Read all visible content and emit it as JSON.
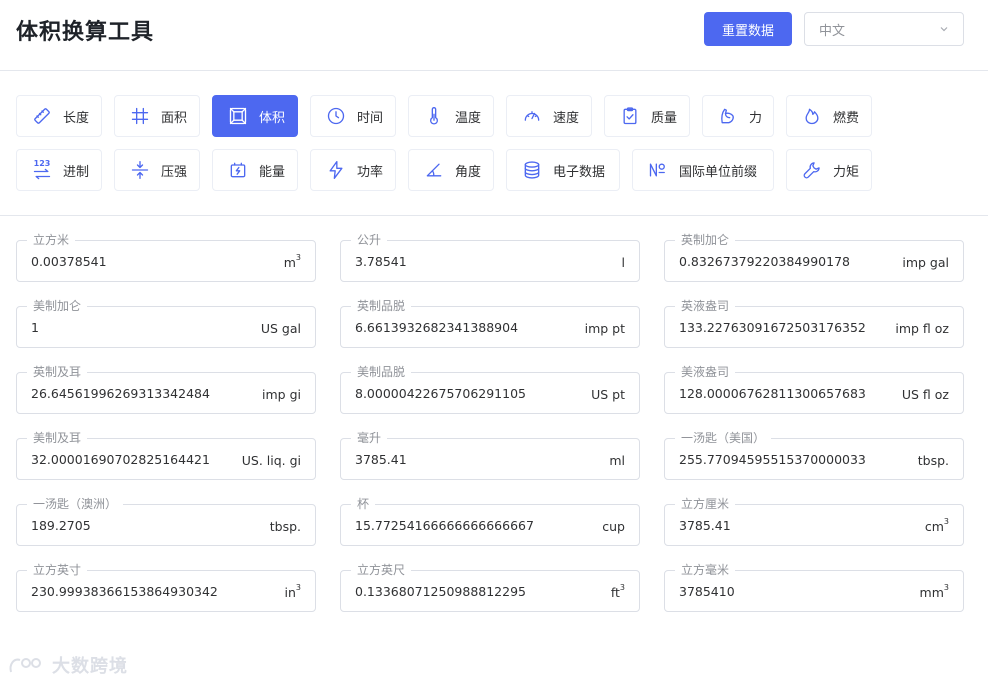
{
  "header": {
    "title": "体积换算工具",
    "reset_label": "重置数据",
    "language": "中文"
  },
  "categories": [
    {
      "label": "长度",
      "icon": "ruler-icon"
    },
    {
      "label": "面积",
      "icon": "grid-icon"
    },
    {
      "label": "体积",
      "icon": "cube-icon",
      "active": true
    },
    {
      "label": "时间",
      "icon": "clock-icon"
    },
    {
      "label": "温度",
      "icon": "thermometer-icon"
    },
    {
      "label": "速度",
      "icon": "speedometer-icon"
    },
    {
      "label": "质量",
      "icon": "clipboard-check-icon"
    },
    {
      "label": "力",
      "icon": "arm-icon"
    },
    {
      "label": "燃费",
      "icon": "flame-icon"
    },
    {
      "label": "进制",
      "icon": "base-123-icon"
    },
    {
      "label": "压强",
      "icon": "compress-icon"
    },
    {
      "label": "能量",
      "icon": "battery-icon"
    },
    {
      "label": "功率",
      "icon": "lightning-icon"
    },
    {
      "label": "角度",
      "icon": "angle-icon"
    },
    {
      "label": "电子数据",
      "icon": "database-icon"
    },
    {
      "label": "国际单位前缀",
      "icon": "numero-icon"
    },
    {
      "label": "力矩",
      "icon": "wrench-icon"
    }
  ],
  "icon_glyph": {
    "base": "123"
  },
  "fields": [
    {
      "label": "立方米",
      "value": "0.00378541",
      "unit": "m",
      "sup": "3"
    },
    {
      "label": "公升",
      "value": "3.78541",
      "unit": "l",
      "sup": ""
    },
    {
      "label": "英制加仑",
      "value": "0.83267379220384990178",
      "unit": "imp gal",
      "sup": ""
    },
    {
      "label": "美制加仑",
      "value": "1",
      "unit": "US gal",
      "sup": ""
    },
    {
      "label": "英制品脱",
      "value": "6.6613932682341388904",
      "unit": "imp pt",
      "sup": ""
    },
    {
      "label": "英液盎司",
      "value": "133.22763091672503176352",
      "unit": "imp fl oz",
      "sup": ""
    },
    {
      "label": "英制及耳",
      "value": "26.64561996269313342484",
      "unit": "imp gi",
      "sup": ""
    },
    {
      "label": "美制品脱",
      "value": "8.00000422675706291105",
      "unit": "US pt",
      "sup": ""
    },
    {
      "label": "美液盎司",
      "value": "128.00006762811300657683",
      "unit": "US fl oz",
      "sup": ""
    },
    {
      "label": "美制及耳",
      "value": "32.00001690702825164421",
      "unit": "US. liq. gi",
      "sup": ""
    },
    {
      "label": "毫升",
      "value": "3785.41",
      "unit": "ml",
      "sup": ""
    },
    {
      "label": "一汤匙（美国）",
      "value": "255.77094595515370000033",
      "unit": "tbsp.",
      "sup": ""
    },
    {
      "label": "一汤匙（澳洲）",
      "value": "189.2705",
      "unit": "tbsp.",
      "sup": ""
    },
    {
      "label": "杯",
      "value": "15.77254166666666666667",
      "unit": "cup",
      "sup": ""
    },
    {
      "label": "立方厘米",
      "value": "3785.41",
      "unit": "cm",
      "sup": "3"
    },
    {
      "label": "立方英寸",
      "value": "230.99938366153864930342",
      "unit": "in",
      "sup": "3"
    },
    {
      "label": "立方英尺",
      "value": "0.13368071250988812295",
      "unit": "ft",
      "sup": "3"
    },
    {
      "label": "立方毫米",
      "value": "3785410",
      "unit": "mm",
      "sup": "3"
    }
  ],
  "watermark": {
    "text": "大数跨境"
  },
  "colors": {
    "accent": "#4d68f0",
    "border": "#dcdfe6",
    "label": "#909399"
  }
}
